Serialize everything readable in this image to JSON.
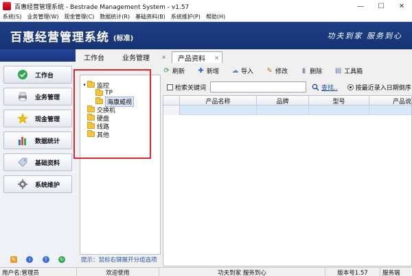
{
  "window": {
    "title": "百惠经营管理系统 - Bestrade Management System - v1.57",
    "minimize": "—",
    "maximize": "☐",
    "close": "✕"
  },
  "menu": [
    "系统(S)",
    "业务管理(W)",
    "现金管理(C)",
    "数据统计(R)",
    "基础资料(B)",
    "系统维护(P)",
    "帮助(H)"
  ],
  "banner": {
    "title": "百惠经营管理系统",
    "edition": "(标准)",
    "slogan": "功夫到家 服务到心"
  },
  "sidebar": {
    "items": [
      {
        "label": "工作台",
        "icon": "check-circle-icon",
        "color": "#2fa84f"
      },
      {
        "label": "业务管理",
        "icon": "printer-icon",
        "color": "#777777"
      },
      {
        "label": "现金管理",
        "icon": "star-icon",
        "color": "#f2c200"
      },
      {
        "label": "数据统计",
        "icon": "bar-chart-icon",
        "color": "#2b6fd6"
      },
      {
        "label": "基础资料",
        "icon": "tag-icon",
        "color": "#8fa4c4"
      },
      {
        "label": "系统维护",
        "icon": "gear-icon",
        "color": "#666666"
      }
    ],
    "footer_icons": [
      "edit-icon",
      "info-icon",
      "help-icon",
      "refresh-icon"
    ]
  },
  "tabs": [
    {
      "label": "工作台",
      "closable": false
    },
    {
      "label": "业务管理",
      "closable": true
    },
    {
      "label": "产品资料",
      "closable": true,
      "active": true
    }
  ],
  "tab_close_glyph": "×",
  "tree": {
    "nodes": [
      {
        "label": "监控",
        "toggle": "▾",
        "level": 0
      },
      {
        "label": "TP",
        "toggle": "",
        "level": 1
      },
      {
        "label": "海康威视",
        "toggle": "",
        "level": 1,
        "selected": true
      },
      {
        "label": "交换机",
        "toggle": "",
        "level": 0
      },
      {
        "label": "硬盘",
        "toggle": "",
        "level": 0
      },
      {
        "label": "线路",
        "toggle": "",
        "level": 0
      },
      {
        "label": "其他",
        "toggle": "",
        "level": 0
      }
    ],
    "hint": "提示：鼠标右键展开分组选项"
  },
  "toolbar": [
    {
      "label": "刷新",
      "icon": "refresh-icon",
      "glyph": "⟳",
      "color": "#2a9d3a"
    },
    {
      "label": "新增",
      "icon": "add-icon",
      "glyph": "✚",
      "color": "#2a62c9"
    },
    {
      "label": "导入",
      "icon": "import-icon",
      "glyph": "☁",
      "color": "#6a86b0"
    },
    {
      "label": "修改",
      "icon": "edit-icon",
      "glyph": "✎",
      "color": "#b07a20"
    },
    {
      "label": "删除",
      "icon": "delete-icon",
      "glyph": "▮",
      "color": "#8a95a8"
    },
    {
      "label": "工具箱",
      "icon": "toolbox-icon",
      "glyph": "▤",
      "color": "#5a78a8"
    }
  ],
  "search": {
    "checkbox_label": "检索关键词",
    "input_value": "",
    "button_label": "查找..",
    "radio_label": "按最近录入日期倒序"
  },
  "grid": {
    "columns": [
      "",
      "产品名称",
      "品牌",
      "型号",
      "产品说"
    ]
  },
  "status": {
    "user": "用户名:管理员",
    "welcome": "欢迎使用",
    "slogan": "功夫到家 服务到心",
    "version": "版本号1.57",
    "service": "服务端"
  }
}
